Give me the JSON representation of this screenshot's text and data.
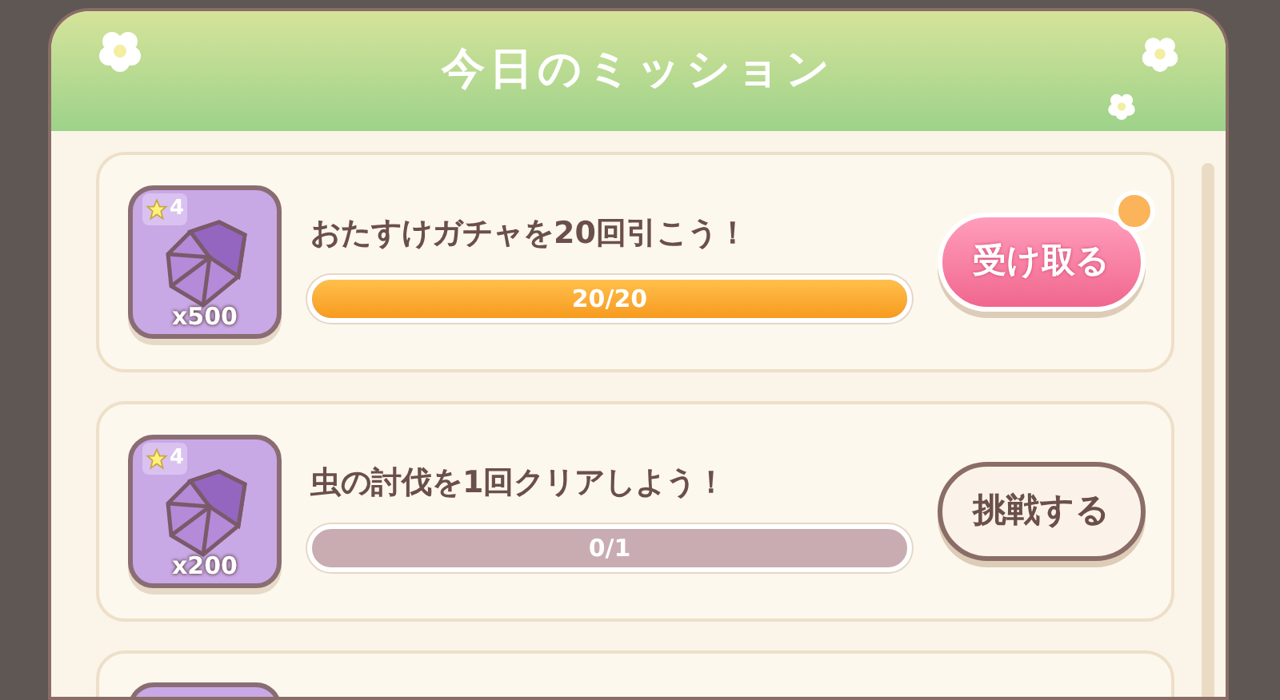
{
  "title": "今日のミッション",
  "missions": [
    {
      "kind": "full",
      "rarity": "4",
      "amount": "x500",
      "text": "おたすけガチャを20回引こう！",
      "level": 1,
      "progress": "20/20",
      "button": {
        "kind": "claim",
        "label": "受け取る",
        "badge": true
      }
    },
    {
      "kind": "full",
      "rarity": "4",
      "amount": "x200",
      "text": "虫の討伐を1回クリアしよう！",
      "level": 0,
      "progress": "0/1",
      "button": {
        "kind": "challenge",
        "label": "挑戦する",
        "badge": false
      }
    },
    {
      "kind": "cut"
    }
  ]
}
